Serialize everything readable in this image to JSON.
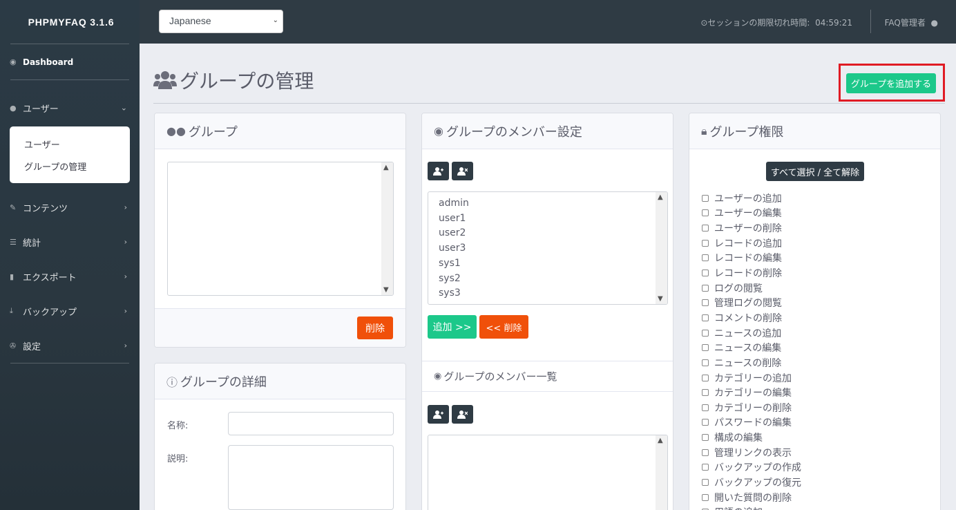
{
  "brand": "PHPMYFAQ 3.1.6",
  "language_select": {
    "value": "Japanese"
  },
  "session": {
    "label": "セッションの期限切れ時間:",
    "time": "04:59:21"
  },
  "user_menu": {
    "label": "FAQ管理者"
  },
  "sidebar": {
    "dashboard": "Dashboard",
    "users": "ユーザー",
    "submenu": [
      "ユーザー",
      "グループの管理"
    ],
    "content": "コンテンツ",
    "statistics": "統計",
    "export": "エクスポート",
    "backup": "バックアップ",
    "settings": "設定"
  },
  "page": {
    "title": "グループの管理",
    "add_group_button": "グループを追加する"
  },
  "groups_card": {
    "title": "グループ",
    "delete_button": "削除"
  },
  "details_card": {
    "title": "グループの詳細",
    "name_label": "名称:",
    "description_label": "説明:"
  },
  "members_card": {
    "title": "グループのメンバー設定",
    "users": [
      "admin",
      "user1",
      "user2",
      "user3",
      "sys1",
      "sys2",
      "sys3"
    ],
    "add_button": "追加 >>",
    "remove_button": "<< 削除",
    "members_list_title": "グループのメンバー一覧"
  },
  "rights_card": {
    "title": "グループ権限",
    "select_all_button": "すべて選択 / 全て解除",
    "permissions": [
      "ユーザーの追加",
      "ユーザーの編集",
      "ユーザーの削除",
      "レコードの追加",
      "レコードの編集",
      "レコードの削除",
      "ログの閲覧",
      "管理ログの閲覧",
      "コメントの削除",
      "ニュースの追加",
      "ニュースの編集",
      "ニュースの削除",
      "カテゴリーの追加",
      "カテゴリーの編集",
      "カテゴリーの削除",
      "パスワードの編集",
      "構成の編集",
      "管理リンクの表示",
      "バックアップの作成",
      "バックアップの復元",
      "開いた質問の削除",
      "用語の追加"
    ]
  },
  "colors": {
    "accent_green": "#1cc88a",
    "danger": "#f0500a",
    "highlight_border": "#e01b24",
    "sidebar": "#2b3a45"
  }
}
